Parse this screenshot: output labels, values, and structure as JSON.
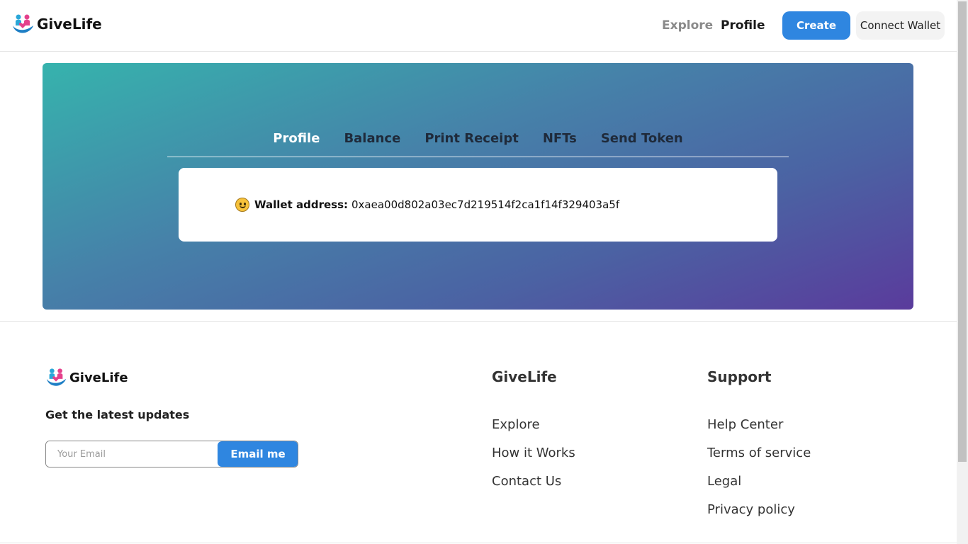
{
  "header": {
    "brand": "GiveLife",
    "nav": {
      "explore": "Explore",
      "profile": "Profile"
    },
    "create_label": "Create",
    "connect_label": "Connect Wallet"
  },
  "hero": {
    "tabs": [
      {
        "label": "Profile",
        "active": true
      },
      {
        "label": "Balance"
      },
      {
        "label": "Print Receipt"
      },
      {
        "label": "NFTs"
      },
      {
        "label": "Send Token"
      }
    ],
    "wallet_label": "Wallet address:",
    "wallet_address": "0xaea00d802a03ec7d219514f2ca1f14f329403a5f"
  },
  "footer": {
    "brand": "GiveLife",
    "updates_title": "Get the latest updates",
    "email_placeholder": "Your Email",
    "email_button": "Email me",
    "col1": {
      "title": "GiveLife",
      "links": [
        "Explore",
        "How it Works",
        "Contact Us"
      ]
    },
    "col2": {
      "title": "Support",
      "links": [
        "Help Center",
        "Terms of service",
        "Legal",
        "Privacy policy"
      ]
    }
  },
  "colors": {
    "primary": "#2f86e0",
    "hero_start": "#36b3ad",
    "hero_end": "#5a3b9c"
  }
}
